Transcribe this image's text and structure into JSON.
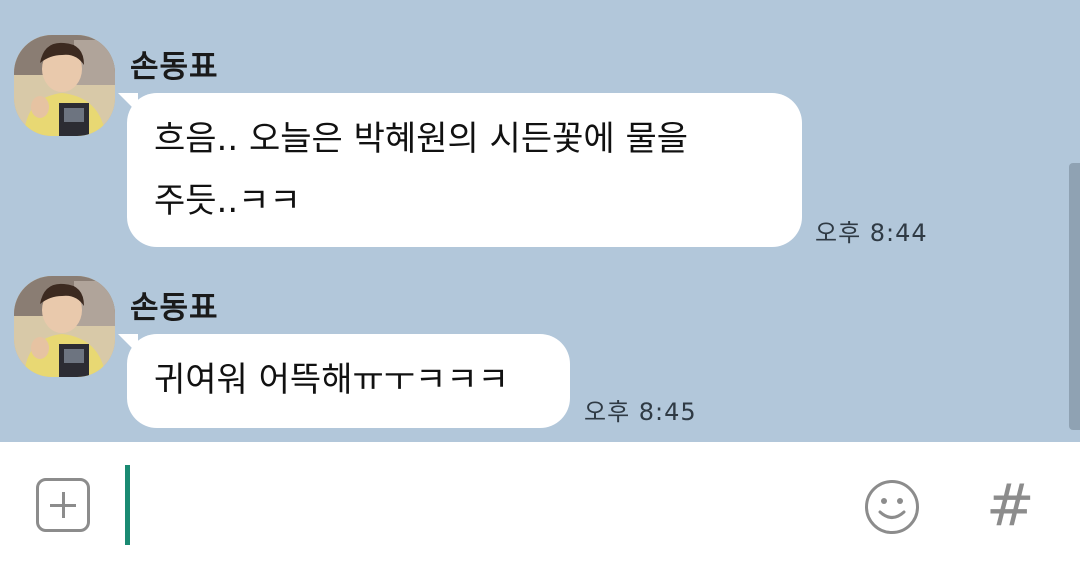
{
  "messages": [
    {
      "sender": "손동표",
      "lines": [
        "흐음.. 오늘은 박혜원의 시든꽃에 물을",
        "주듯..ㅋㅋ"
      ],
      "time": "오후 8:44"
    },
    {
      "sender": "손동표",
      "lines": [
        "귀여워 어뜩해ㅠㅜㅋㅋㅋ"
      ],
      "time": "오후 8:45"
    }
  ],
  "input": {
    "value": "",
    "placeholder": ""
  },
  "icons": {
    "add": "add-icon",
    "emoji": "emoji-icon",
    "hashtag": "hashtag-icon",
    "hashtag_glyph": "#"
  },
  "colors": {
    "chat_background": "#b2c7da",
    "bubble": "#ffffff",
    "caret": "#1a8a72",
    "icon_gray": "#8c8c8c"
  }
}
